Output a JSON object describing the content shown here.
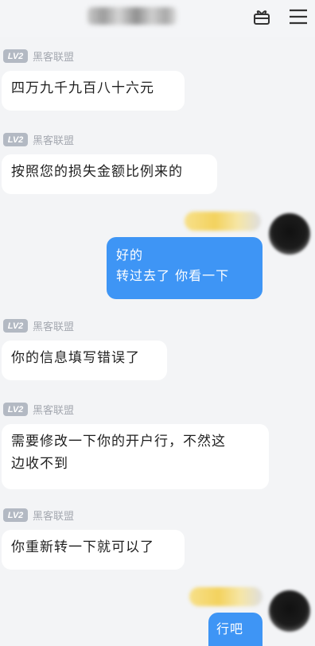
{
  "header": {
    "title_obscured": true,
    "icons": [
      "gift-box-icon",
      "menu-icon"
    ]
  },
  "messages": [
    {
      "direction": "incoming",
      "level": "LV2",
      "sender": "黑客联盟",
      "text": "四万九千九百八十六元"
    },
    {
      "direction": "incoming",
      "level": "LV2",
      "sender": "黑客联盟",
      "text": "按照您的损失金额比例来的"
    },
    {
      "direction": "outgoing",
      "lines": [
        "好的",
        "转过去了 你看一下"
      ]
    },
    {
      "direction": "incoming",
      "level": "LV2",
      "sender": "黑客联盟",
      "text": "你的信息填写错误了"
    },
    {
      "direction": "incoming",
      "level": "LV2",
      "sender": "黑客联盟",
      "lines": [
        "需要修改一下你的开户行，不然这",
        "边收不到"
      ]
    },
    {
      "direction": "incoming",
      "level": "LV2",
      "sender": "黑客联盟",
      "text": "你重新转一下就可以了"
    },
    {
      "direction": "outgoing",
      "text": "行吧"
    }
  ],
  "colors": {
    "background": "#f3f4f6",
    "incoming_bubble": "#ffffff",
    "outgoing_bubble": "#3e95f5",
    "level_badge": "#b3b9c3",
    "sender_name": "#a4a8b0"
  }
}
